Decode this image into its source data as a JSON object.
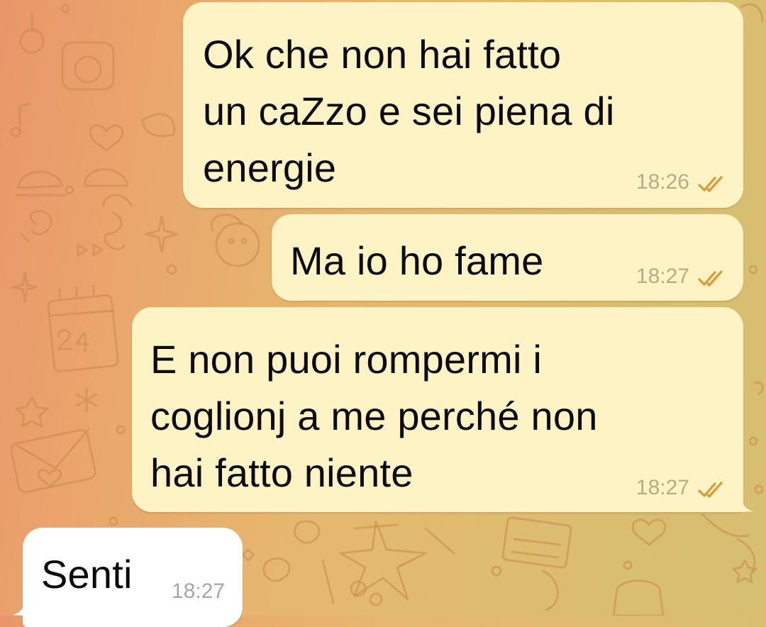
{
  "chat": {
    "messages": [
      {
        "direction": "outgoing",
        "lines": [
          "Ok che non hai fatto",
          "un caZzo e sei piena di",
          "energie"
        ],
        "time": "18:26",
        "status": "read",
        "status_icon": "double-check-icon"
      },
      {
        "direction": "outgoing",
        "lines": [
          "Ma io ho fame"
        ],
        "time": "18:27",
        "status": "read",
        "status_icon": "double-check-icon"
      },
      {
        "direction": "outgoing",
        "lines": [
          "E non puoi rompermi i",
          "coglionj a me perché non",
          "hai fatto niente"
        ],
        "time": "18:27",
        "status": "read",
        "status_icon": "double-check-icon"
      },
      {
        "direction": "incoming",
        "lines": [
          "Senti"
        ],
        "time": "18:27"
      }
    ]
  },
  "colors": {
    "outgoing_bubble": "#fdf3c4",
    "incoming_bubble": "#ffffff",
    "read_ticks": "#dc9a36",
    "wallpaper_start": "#e9966a",
    "wallpaper_end": "#d6bf72"
  }
}
